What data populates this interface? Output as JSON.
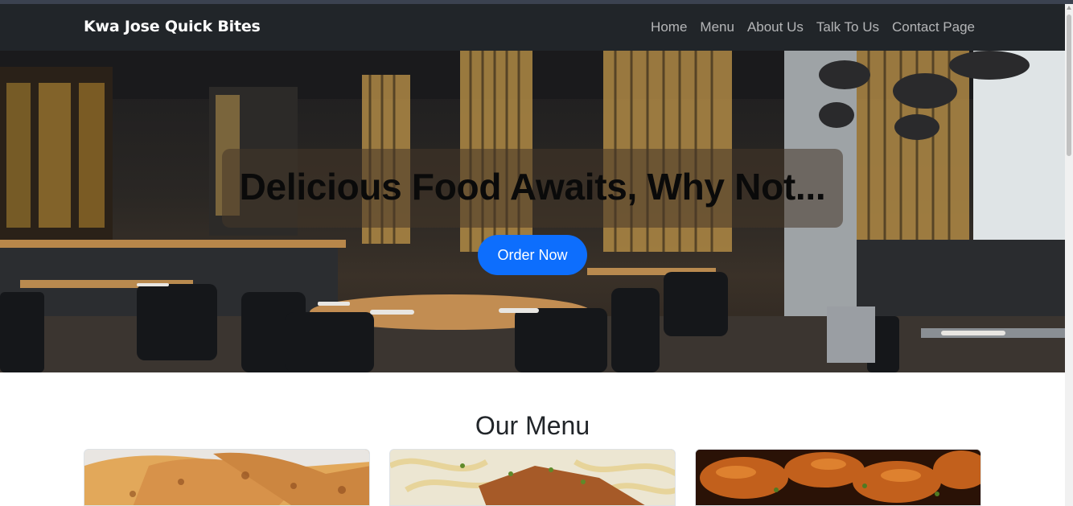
{
  "navbar": {
    "brand": "Kwa Jose Quick Bites",
    "links": [
      "Home",
      "Menu",
      "About Us",
      "Talk To Us",
      "Contact Page"
    ]
  },
  "hero": {
    "headline": "Delicious Food Awaits, Why Not...",
    "cta_label": "Order Now"
  },
  "menu_section": {
    "title": "Our Menu",
    "cards": [
      {
        "image": "chapati-photo"
      },
      {
        "image": "chicken-pasta-photo"
      },
      {
        "image": "chicken-wings-photo"
      }
    ]
  },
  "colors": {
    "navbar_bg": "#212529",
    "cta_bg": "#0d6efd",
    "nav_link": "rgba(255,255,255,0.66)"
  }
}
